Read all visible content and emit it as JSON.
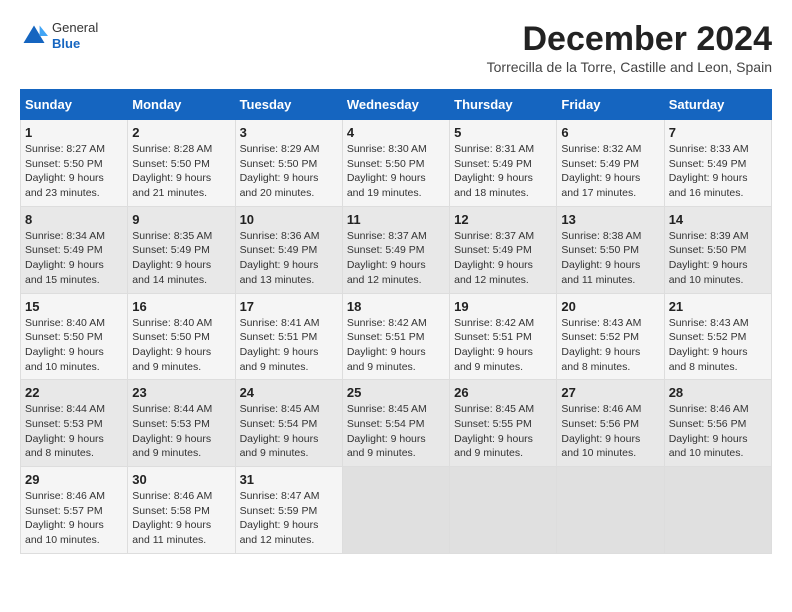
{
  "header": {
    "logo_general": "General",
    "logo_blue": "Blue",
    "month_title": "December 2024",
    "location": "Torrecilla de la Torre, Castille and Leon, Spain"
  },
  "calendar": {
    "days_of_week": [
      "Sunday",
      "Monday",
      "Tuesday",
      "Wednesday",
      "Thursday",
      "Friday",
      "Saturday"
    ],
    "weeks": [
      [
        {
          "day": "",
          "info": ""
        },
        {
          "day": "2",
          "info": "Sunrise: 8:28 AM\nSunset: 5:50 PM\nDaylight: 9 hours\nand 21 minutes."
        },
        {
          "day": "3",
          "info": "Sunrise: 8:29 AM\nSunset: 5:50 PM\nDaylight: 9 hours\nand 20 minutes."
        },
        {
          "day": "4",
          "info": "Sunrise: 8:30 AM\nSunset: 5:50 PM\nDaylight: 9 hours\nand 19 minutes."
        },
        {
          "day": "5",
          "info": "Sunrise: 8:31 AM\nSunset: 5:49 PM\nDaylight: 9 hours\nand 18 minutes."
        },
        {
          "day": "6",
          "info": "Sunrise: 8:32 AM\nSunset: 5:49 PM\nDaylight: 9 hours\nand 17 minutes."
        },
        {
          "day": "7",
          "info": "Sunrise: 8:33 AM\nSunset: 5:49 PM\nDaylight: 9 hours\nand 16 minutes."
        }
      ],
      [
        {
          "day": "8",
          "info": "Sunrise: 8:34 AM\nSunset: 5:49 PM\nDaylight: 9 hours\nand 15 minutes."
        },
        {
          "day": "9",
          "info": "Sunrise: 8:35 AM\nSunset: 5:49 PM\nDaylight: 9 hours\nand 14 minutes."
        },
        {
          "day": "10",
          "info": "Sunrise: 8:36 AM\nSunset: 5:49 PM\nDaylight: 9 hours\nand 13 minutes."
        },
        {
          "day": "11",
          "info": "Sunrise: 8:37 AM\nSunset: 5:49 PM\nDaylight: 9 hours\nand 12 minutes."
        },
        {
          "day": "12",
          "info": "Sunrise: 8:37 AM\nSunset: 5:49 PM\nDaylight: 9 hours\nand 12 minutes."
        },
        {
          "day": "13",
          "info": "Sunrise: 8:38 AM\nSunset: 5:50 PM\nDaylight: 9 hours\nand 11 minutes."
        },
        {
          "day": "14",
          "info": "Sunrise: 8:39 AM\nSunset: 5:50 PM\nDaylight: 9 hours\nand 10 minutes."
        }
      ],
      [
        {
          "day": "15",
          "info": "Sunrise: 8:40 AM\nSunset: 5:50 PM\nDaylight: 9 hours\nand 10 minutes."
        },
        {
          "day": "16",
          "info": "Sunrise: 8:40 AM\nSunset: 5:50 PM\nDaylight: 9 hours\nand 9 minutes."
        },
        {
          "day": "17",
          "info": "Sunrise: 8:41 AM\nSunset: 5:51 PM\nDaylight: 9 hours\nand 9 minutes."
        },
        {
          "day": "18",
          "info": "Sunrise: 8:42 AM\nSunset: 5:51 PM\nDaylight: 9 hours\nand 9 minutes."
        },
        {
          "day": "19",
          "info": "Sunrise: 8:42 AM\nSunset: 5:51 PM\nDaylight: 9 hours\nand 9 minutes."
        },
        {
          "day": "20",
          "info": "Sunrise: 8:43 AM\nSunset: 5:52 PM\nDaylight: 9 hours\nand 8 minutes."
        },
        {
          "day": "21",
          "info": "Sunrise: 8:43 AM\nSunset: 5:52 PM\nDaylight: 9 hours\nand 8 minutes."
        }
      ],
      [
        {
          "day": "22",
          "info": "Sunrise: 8:44 AM\nSunset: 5:53 PM\nDaylight: 9 hours\nand 8 minutes."
        },
        {
          "day": "23",
          "info": "Sunrise: 8:44 AM\nSunset: 5:53 PM\nDaylight: 9 hours\nand 9 minutes."
        },
        {
          "day": "24",
          "info": "Sunrise: 8:45 AM\nSunset: 5:54 PM\nDaylight: 9 hours\nand 9 minutes."
        },
        {
          "day": "25",
          "info": "Sunrise: 8:45 AM\nSunset: 5:54 PM\nDaylight: 9 hours\nand 9 minutes."
        },
        {
          "day": "26",
          "info": "Sunrise: 8:45 AM\nSunset: 5:55 PM\nDaylight: 9 hours\nand 9 minutes."
        },
        {
          "day": "27",
          "info": "Sunrise: 8:46 AM\nSunset: 5:56 PM\nDaylight: 9 hours\nand 10 minutes."
        },
        {
          "day": "28",
          "info": "Sunrise: 8:46 AM\nSunset: 5:56 PM\nDaylight: 9 hours\nand 10 minutes."
        }
      ],
      [
        {
          "day": "29",
          "info": "Sunrise: 8:46 AM\nSunset: 5:57 PM\nDaylight: 9 hours\nand 10 minutes."
        },
        {
          "day": "30",
          "info": "Sunrise: 8:46 AM\nSunset: 5:58 PM\nDaylight: 9 hours\nand 11 minutes."
        },
        {
          "day": "31",
          "info": "Sunrise: 8:47 AM\nSunset: 5:59 PM\nDaylight: 9 hours\nand 12 minutes."
        },
        {
          "day": "",
          "info": ""
        },
        {
          "day": "",
          "info": ""
        },
        {
          "day": "",
          "info": ""
        },
        {
          "day": "",
          "info": ""
        }
      ]
    ],
    "first_week_sunday": {
      "day": "1",
      "info": "Sunrise: 8:27 AM\nSunset: 5:50 PM\nDaylight: 9 hours\nand 23 minutes."
    }
  }
}
